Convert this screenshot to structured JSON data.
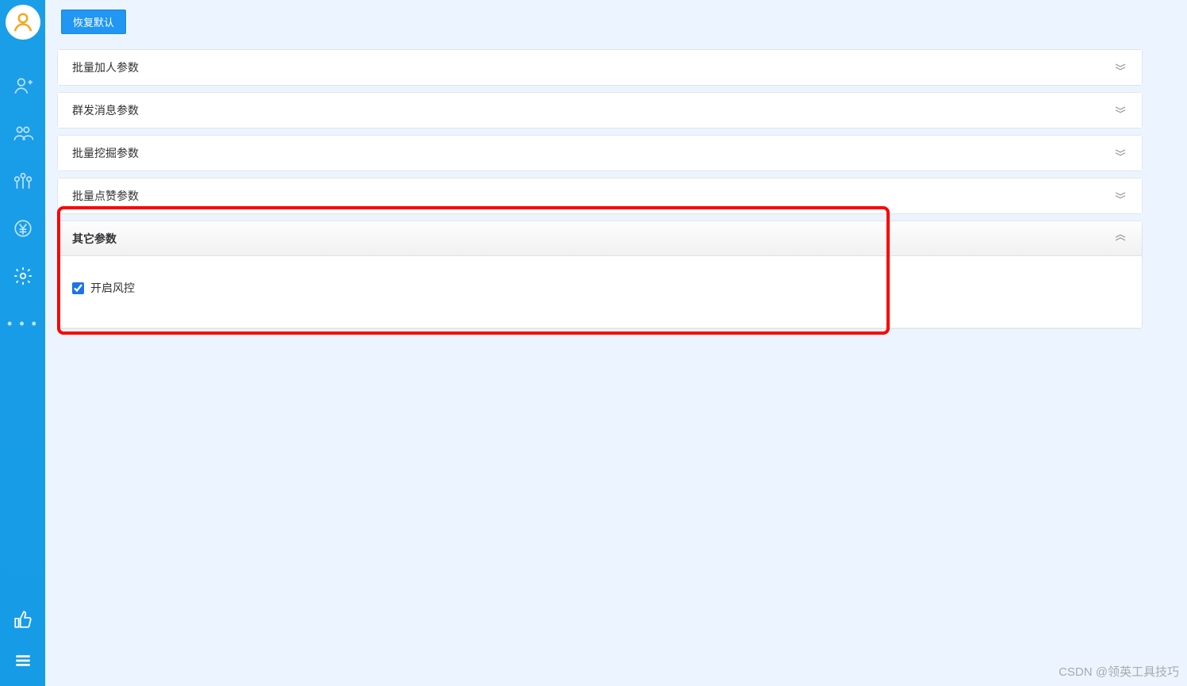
{
  "topbar": {
    "restore_default": "恢复默认"
  },
  "panels": {
    "batch_add": "批量加人参数",
    "mass_message": "群发消息参数",
    "batch_mine": "批量挖掘参数",
    "batch_like": "批量点赞参数",
    "other": "其它参数"
  },
  "other_params": {
    "risk_control_label": "开启风控",
    "risk_control_checked": true
  },
  "watermark": "CSDN @领英工具技巧"
}
